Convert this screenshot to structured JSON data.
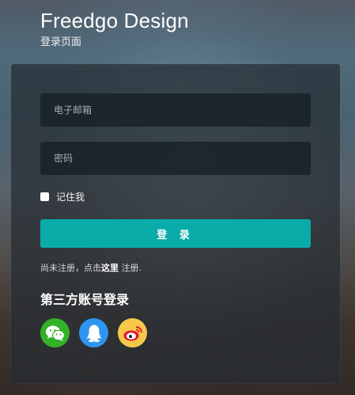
{
  "brand": {
    "title": "Freedgo Design",
    "subtitle": "登录页面"
  },
  "login_form": {
    "email_placeholder": "电子邮箱",
    "password_placeholder": "密码",
    "remember_label": "记住我",
    "submit_label": "登 录",
    "register_prefix": "尚未注册，点击",
    "register_link": "这里",
    "register_suffix": " 注册."
  },
  "third_party": {
    "title": "第三方账号登录",
    "providers": [
      {
        "name": "wechat",
        "icon": "wechat-icon",
        "color": "#31b228"
      },
      {
        "name": "qq",
        "icon": "qq-icon",
        "color": "#2e96f0"
      },
      {
        "name": "weibo",
        "icon": "weibo-icon",
        "color": "#f6c94a"
      }
    ]
  },
  "colors": {
    "accent": "#0aacaa"
  }
}
